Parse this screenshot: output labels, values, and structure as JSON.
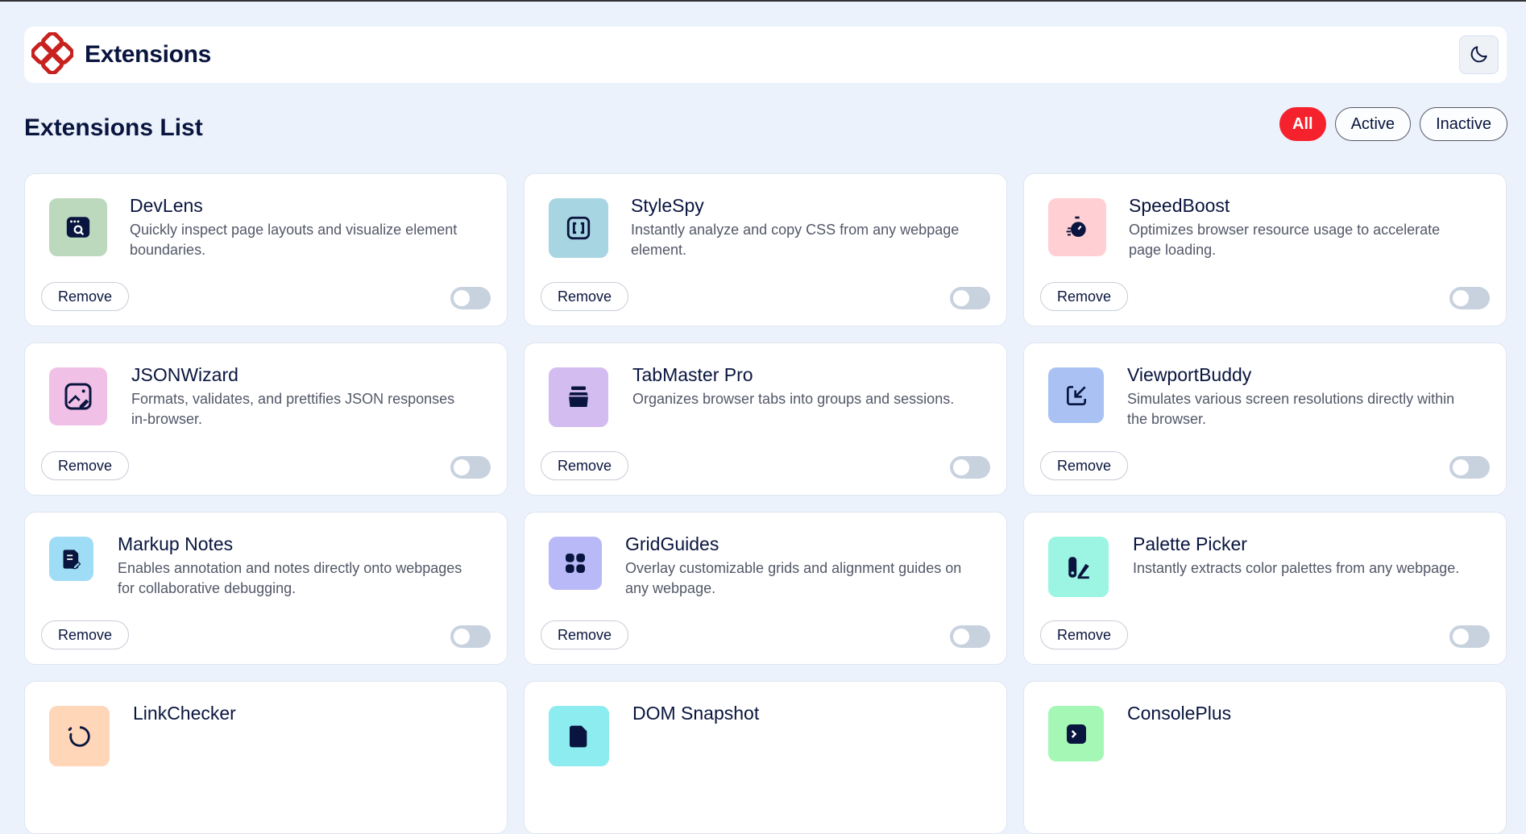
{
  "app": {
    "title": "Extensions"
  },
  "section": {
    "title": "Extensions List"
  },
  "filters": [
    {
      "label": "All",
      "active": true
    },
    {
      "label": "Active",
      "active": false
    },
    {
      "label": "Inactive",
      "active": false
    }
  ],
  "colors": {
    "accent": "#f5222d",
    "brand": "#c7221f",
    "toggle_off": "#c8d2de"
  },
  "extensions": [
    {
      "name": "DevLens",
      "description": "Quickly inspect page layouts and visualize element boundaries.",
      "icon": "inspect-icon",
      "icon_bg": "#bcd9bd",
      "remove_label": "Remove",
      "enabled": false
    },
    {
      "name": "StyleSpy",
      "description": "Instantly analyze and copy CSS from any webpage element.",
      "icon": "css-brackets-icon",
      "icon_bg": "#a8d5e2",
      "remove_label": "Remove",
      "enabled": false
    },
    {
      "name": "SpeedBoost",
      "description": "Optimizes browser resource usage to accelerate page loading.",
      "icon": "stopwatch-icon",
      "icon_bg": "#ffcfd3",
      "remove_label": "Remove",
      "enabled": false
    },
    {
      "name": "JSONWizard",
      "description": "Formats, validates, and prettifies JSON responses in-browser.",
      "icon": "magic-image-icon",
      "icon_bg": "#f1c0e6",
      "remove_label": "Remove",
      "enabled": false
    },
    {
      "name": "TabMaster Pro",
      "description": "Organizes browser tabs into groups and sessions.",
      "icon": "jar-icon",
      "icon_bg": "#d3bcf0",
      "remove_label": "Remove",
      "enabled": false
    },
    {
      "name": "ViewportBuddy",
      "description": "Simulates various screen resolutions directly within the browser.",
      "icon": "resize-arrow-icon",
      "icon_bg": "#a9c2f3",
      "remove_label": "Remove",
      "enabled": false
    },
    {
      "name": "Markup Notes",
      "description": "Enables annotation and notes directly onto webpages for collaborative debugging.",
      "icon": "note-pen-icon",
      "icon_bg": "#9fdcf5",
      "remove_label": "Remove",
      "enabled": false
    },
    {
      "name": "GridGuides",
      "description": "Overlay customizable grids and alignment guides on any webpage.",
      "icon": "grid-icon",
      "icon_bg": "#b8b9f6",
      "remove_label": "Remove",
      "enabled": false
    },
    {
      "name": "Palette Picker",
      "description": "Instantly extracts color palettes from any webpage.",
      "icon": "palette-icon",
      "icon_bg": "#9cf5e2",
      "remove_label": "Remove",
      "enabled": false
    },
    {
      "name": "LinkChecker",
      "description": "",
      "icon": "link-check-icon",
      "icon_bg": "#ffd6b8",
      "remove_label": "",
      "enabled": false
    },
    {
      "name": "DOM Snapshot",
      "description": "",
      "icon": "document-icon",
      "icon_bg": "#8cecf0",
      "remove_label": "",
      "enabled": false
    },
    {
      "name": "ConsolePlus",
      "description": "",
      "icon": "terminal-icon",
      "icon_bg": "#a5f7b5",
      "remove_label": "",
      "enabled": false
    }
  ]
}
